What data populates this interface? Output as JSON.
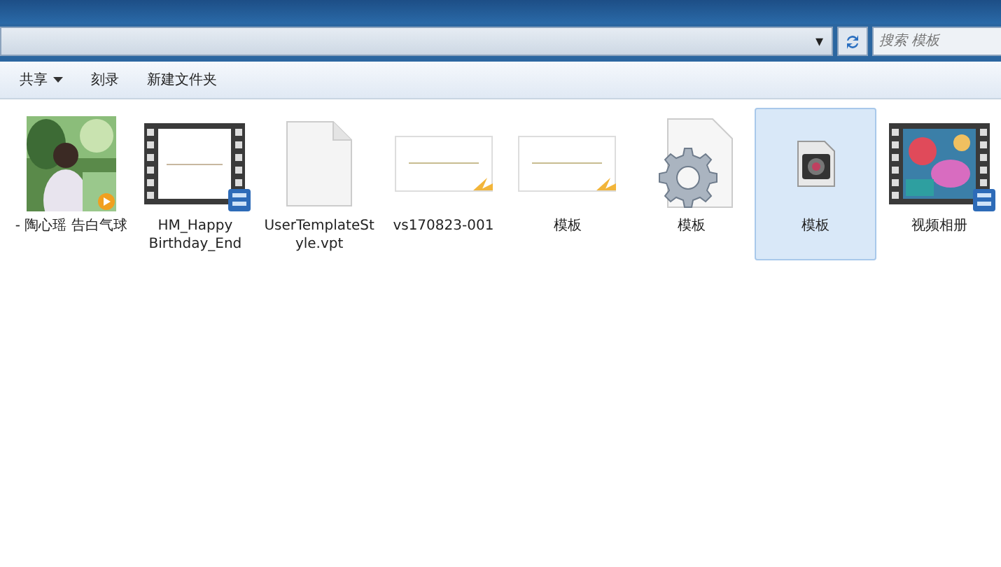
{
  "address_bar": {
    "dropdown": "▾"
  },
  "search": {
    "placeholder": "搜索 模板"
  },
  "toolbar": [
    {
      "label": "共享",
      "has_menu": true
    },
    {
      "label": "刻录",
      "has_menu": false
    },
    {
      "label": "新建文件夹",
      "has_menu": false
    }
  ],
  "files": [
    {
      "name": "- 陶心瑶 告白气球",
      "selected": false
    },
    {
      "name": "HM_Happy Birthday_End",
      "kind": "video",
      "selected": false
    },
    {
      "name": "UserTemplateStyle.vpt",
      "kind": "document",
      "selected": false
    },
    {
      "name": "vs170823-001",
      "kind": "slide",
      "selected": false
    },
    {
      "name": "模板",
      "kind": "slide",
      "selected": false
    },
    {
      "name": "模板",
      "kind": "settings",
      "selected": false
    },
    {
      "name": "模板",
      "kind": "media",
      "selected": true
    },
    {
      "name": "视频相册",
      "kind": "video_picture",
      "selected": false
    }
  ]
}
